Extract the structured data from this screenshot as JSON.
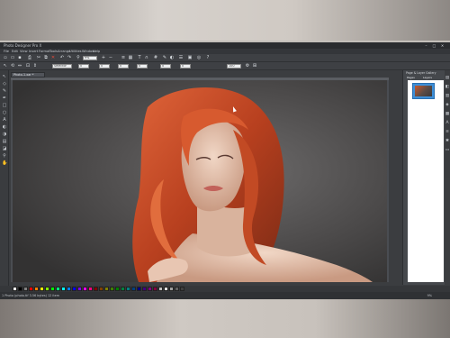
{
  "window": {
    "title": "Photo Designer Pro X",
    "controls": [
      "–",
      "□",
      "✕"
    ]
  },
  "menu": [
    "File",
    "Edit",
    "View",
    "Insert",
    "Format",
    "Tools",
    "Arrange",
    "Utilities",
    "Window",
    "Help"
  ],
  "toolbar1": {
    "zoom_value": "9%",
    "icons": [
      "new-icon",
      "open-icon",
      "save-icon",
      "print-icon",
      "cut-icon",
      "copy-icon",
      "paste-icon",
      "delete-icon",
      "undo-icon",
      "redo-icon"
    ]
  },
  "toolbar2": {
    "selector_value": "Selector",
    "field_values": [
      "0",
      "0",
      "0",
      "0",
      "0",
      "0",
      "100"
    ]
  },
  "document": {
    "tab_label": "Photo-1.xar *"
  },
  "right_panel": {
    "title": "Page & Layer Gallery",
    "tabs": [
      "Pages",
      "Layers"
    ]
  },
  "status": {
    "text": "1 Photo (photo.tif 3.56 bytes) 12 item",
    "zoom": "9%"
  },
  "palette_colors": [
    "#ffffff",
    "#000000",
    "#7f7f7f",
    "#ff0000",
    "#ff7f00",
    "#ffff00",
    "#7fff00",
    "#00ff00",
    "#00ff7f",
    "#00ffff",
    "#007fff",
    "#0000ff",
    "#7f00ff",
    "#ff00ff",
    "#ff007f",
    "#7f0000",
    "#7f3f00",
    "#7f7f00",
    "#3f7f00",
    "#007f00",
    "#007f3f",
    "#007f7f",
    "#003f7f",
    "#00007f",
    "#3f007f",
    "#7f007f",
    "#7f003f",
    "#bfbfbf",
    "#dfdfdf",
    "#9f9f9f",
    "#5f5f5f",
    "#3f3f3f"
  ],
  "image": {
    "subject": "Photo-1"
  }
}
